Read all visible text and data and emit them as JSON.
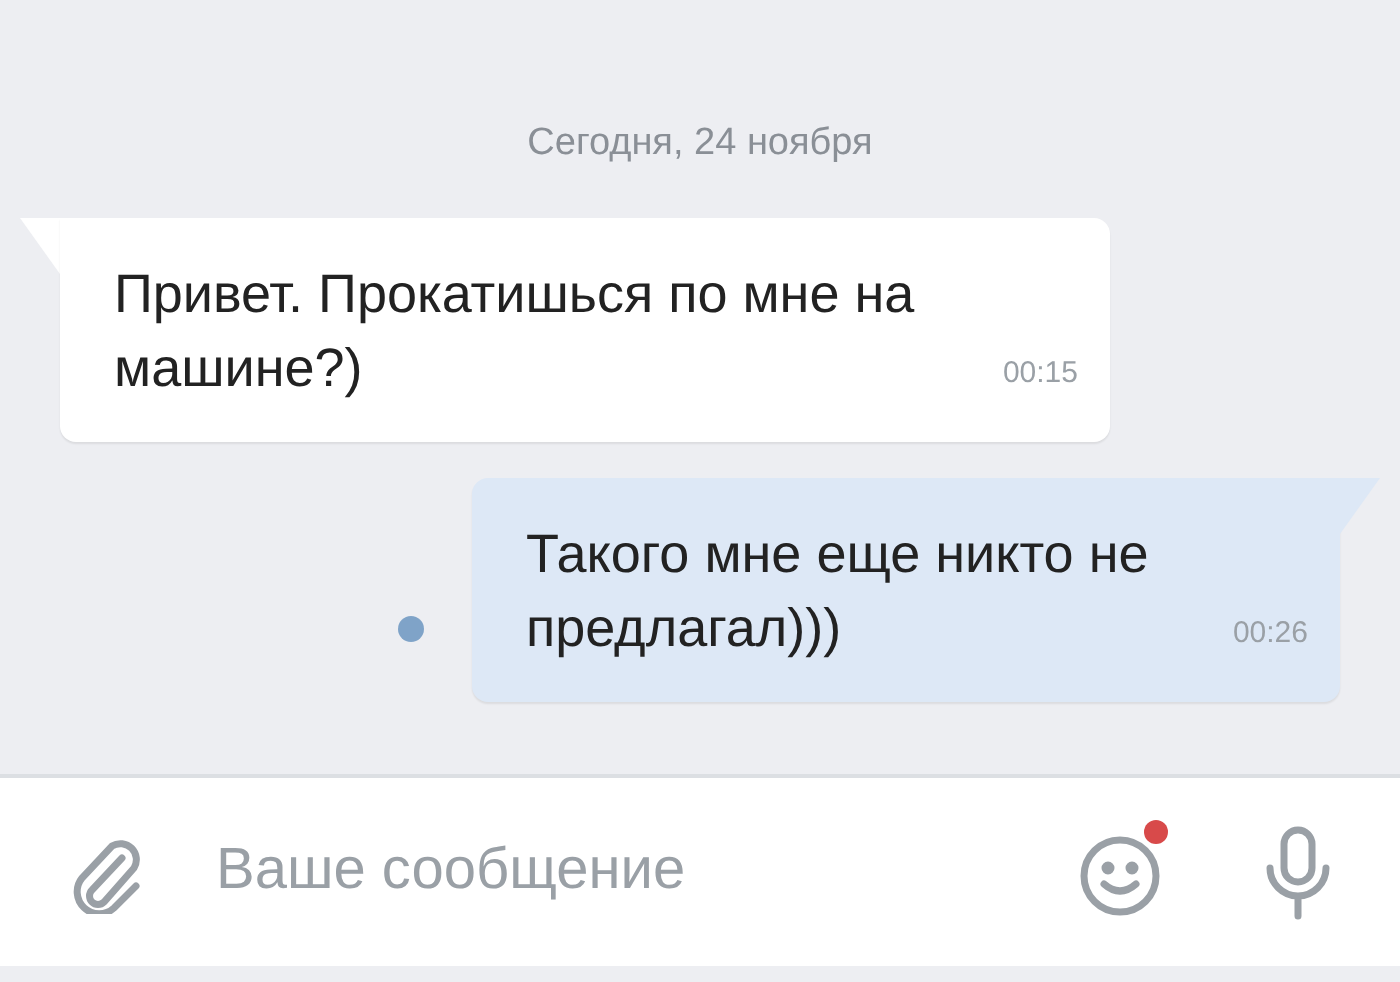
{
  "date_divider": "Сегодня, 24 ноября",
  "messages": [
    {
      "text": "Привет. Прокатишься по мне на машине?)",
      "time": "00:15",
      "outgoing": false,
      "unread": false
    },
    {
      "text": "Такого мне еще никто не предлагал)))",
      "time": "00:26",
      "outgoing": true,
      "unread": true
    }
  ],
  "composer": {
    "placeholder": "Ваше сообщение"
  }
}
